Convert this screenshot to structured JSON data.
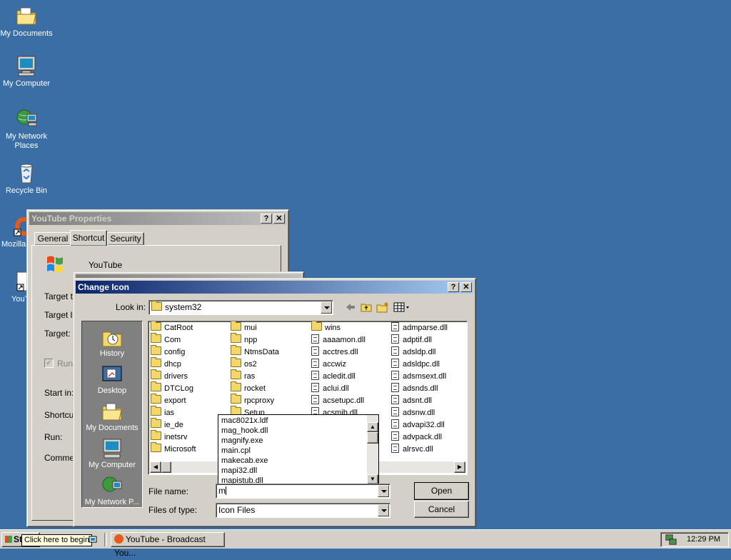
{
  "desktop": {
    "icons": [
      {
        "label": "My Documents",
        "icon": "my-documents-icon"
      },
      {
        "label": "My Computer",
        "icon": "my-computer-icon"
      },
      {
        "label": "My Network Places",
        "icon": "network-places-icon"
      },
      {
        "label": "Recycle Bin",
        "icon": "recycle-bin-icon"
      },
      {
        "label": "Mozilla",
        "icon": "mozilla-shortcut-icon"
      },
      {
        "label": "YouT",
        "icon": "youtube-shortcut-icon"
      }
    ],
    "background_color": "#3a6ea5"
  },
  "properties_window": {
    "title": "YouTube Properties",
    "tabs": [
      "General",
      "Shortcut",
      "Security"
    ],
    "name": "YouTube",
    "fields": [
      "Target t",
      "Target lo",
      "Target:",
      "Run",
      "Start in:",
      "Shortcu",
      "Run:",
      "Commen"
    ]
  },
  "change_icon": {
    "title": "Change Icon",
    "look_in_label": "Look in:",
    "look_in_value": "system32",
    "places": [
      "History",
      "Desktop",
      "My Documents",
      "My Computer",
      "My Network P..."
    ],
    "columns": [
      [
        {
          "name": "CatRoot",
          "type": "folder"
        },
        {
          "name": "Com",
          "type": "folder"
        },
        {
          "name": "config",
          "type": "folder"
        },
        {
          "name": "dhcp",
          "type": "folder"
        },
        {
          "name": "drivers",
          "type": "folder"
        },
        {
          "name": "DTCLog",
          "type": "folder"
        },
        {
          "name": "export",
          "type": "folder"
        },
        {
          "name": "ias",
          "type": "folder"
        },
        {
          "name": "ie_de",
          "type": "folder"
        },
        {
          "name": "inetsrv",
          "type": "folder"
        },
        {
          "name": "Microsoft",
          "type": "folder"
        }
      ],
      [
        {
          "name": "mui",
          "type": "folder"
        },
        {
          "name": "npp",
          "type": "folder"
        },
        {
          "name": "NtmsData",
          "type": "folder"
        },
        {
          "name": "os2",
          "type": "folder"
        },
        {
          "name": "ras",
          "type": "folder"
        },
        {
          "name": "rocket",
          "type": "folder"
        },
        {
          "name": "rpcproxy",
          "type": "folder"
        },
        {
          "name": "Setup",
          "type": "folder"
        }
      ],
      [
        {
          "name": "wins",
          "type": "folder"
        },
        {
          "name": "aaaamon.dll",
          "type": "file"
        },
        {
          "name": "acctres.dll",
          "type": "file"
        },
        {
          "name": "accwiz",
          "type": "file"
        },
        {
          "name": "acledit.dll",
          "type": "file"
        },
        {
          "name": "aclui.dll",
          "type": "file"
        },
        {
          "name": "acsetupc.dll",
          "type": "file"
        },
        {
          "name": "acsmib.dll",
          "type": "file"
        }
      ],
      [
        {
          "name": "admparse.dll",
          "type": "file"
        },
        {
          "name": "adptif.dll",
          "type": "file"
        },
        {
          "name": "adsldp.dll",
          "type": "file"
        },
        {
          "name": "adsldpc.dll",
          "type": "file"
        },
        {
          "name": "adsmsext.dll",
          "type": "file"
        },
        {
          "name": "adsnds.dll",
          "type": "file"
        },
        {
          "name": "adsnt.dll",
          "type": "file"
        },
        {
          "name": "adsnw.dll",
          "type": "file"
        },
        {
          "name": "advapi32.dll",
          "type": "file"
        },
        {
          "name": "advpack.dll",
          "type": "file"
        },
        {
          "name": "alrsvc.dll",
          "type": "file"
        }
      ]
    ],
    "autocomplete": [
      "mac8021x.ldf",
      "mag_hook.dll",
      "magnify.exe",
      "main.cpl",
      "makecab.exe",
      "mapi32.dll",
      "mapistub.dll"
    ],
    "file_name_label": "File name:",
    "file_name_value": "m",
    "files_of_type_label": "Files of type:",
    "files_of_type_value": "Icon Files",
    "open_label": "Open",
    "cancel_label": "Cancel"
  },
  "taskbar": {
    "start_tooltip": "Click here to begin",
    "start_label": "St",
    "task_label": "YouTube - Broadcast You...",
    "clock": "12:29 PM"
  }
}
